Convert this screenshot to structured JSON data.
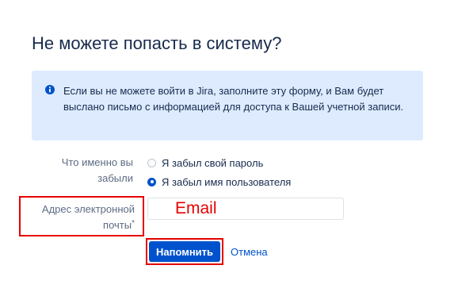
{
  "title": "Не можете попасть в систему?",
  "info": {
    "icon": "info-icon",
    "text": "Если вы не можете войти в Jira, заполните эту форму, и Вам будет выслано письмо с информацией для доступа к Вашей учетной записи."
  },
  "form": {
    "question_label": "Что именно вы забыли",
    "options": [
      {
        "label": "Я забыл свой пароль",
        "selected": false
      },
      {
        "label": "Я забыл имя пользователя",
        "selected": true
      }
    ],
    "email_label": "Адрес электронной почты",
    "email_required_marker": "*",
    "email_placeholder": "Email",
    "submit_label": "Напомнить",
    "cancel_label": "Отмена"
  },
  "colors": {
    "primary": "#0052cc",
    "info_background": "#deebff",
    "annotation_red": "#e60000"
  }
}
